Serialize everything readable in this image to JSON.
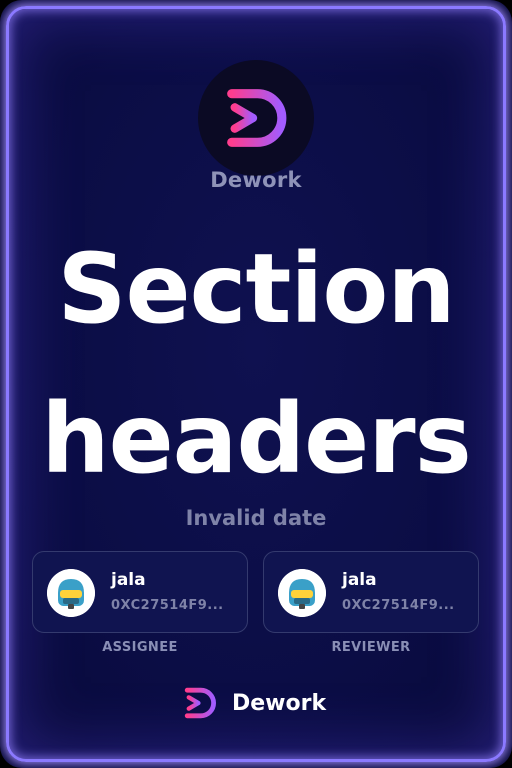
{
  "brand": {
    "name_top": "Dework",
    "name_footer": "Dework",
    "logo_icon": "dework-logo-icon",
    "colors": {
      "gradient_start": "#ff3d8e",
      "gradient_end": "#a25cff",
      "background": "#0b0d45",
      "glow": "#8b79ff"
    }
  },
  "title": {
    "line1": "Section",
    "line2": "headers"
  },
  "date_text": "Invalid date",
  "assignee": {
    "name": "jala",
    "address": "0XC27514F9...",
    "role": "ASSIGNEE",
    "avatar_icon": "helmet-avatar-icon"
  },
  "reviewer": {
    "name": "jala",
    "address": "0XC27514F9...",
    "role": "REVIEWER",
    "avatar_icon": "helmet-avatar-icon"
  }
}
